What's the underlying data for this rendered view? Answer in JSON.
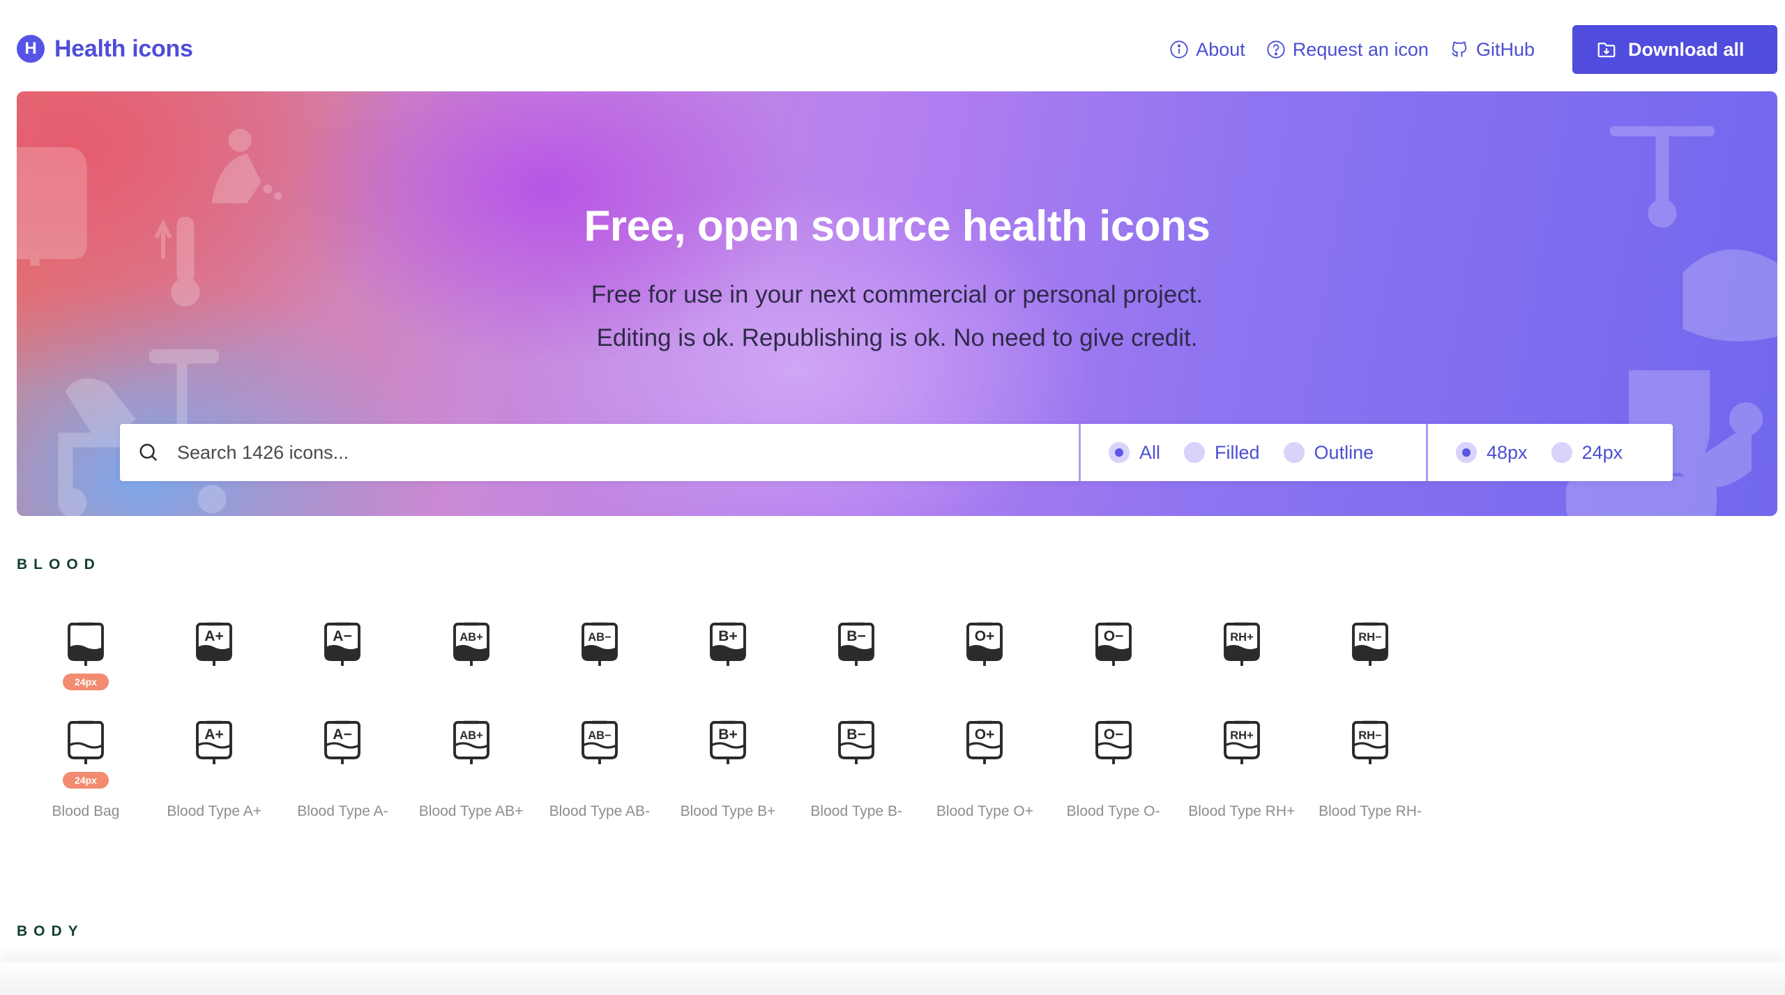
{
  "header": {
    "logo_letter": "H",
    "logo_text": "Health icons",
    "nav": {
      "about": "About",
      "request": "Request an icon",
      "github": "GitHub"
    },
    "download_label": "Download all"
  },
  "hero": {
    "title": "Free, open source health icons",
    "subtitle_line1": "Free for use in your next commercial or personal project.",
    "subtitle_line2": "Editing is ok. Republishing is ok. No need to give credit."
  },
  "search": {
    "placeholder": "Search 1426 icons...",
    "style_options": [
      "All",
      "Filled",
      "Outline"
    ],
    "style_selected": "All",
    "size_options": [
      "48px",
      "24px"
    ],
    "size_selected": "48px"
  },
  "sections": [
    {
      "title": "BLOOD",
      "badge": "24px",
      "icons": [
        {
          "label": "Blood Bag",
          "glyph": ""
        },
        {
          "label": "Blood Type A+",
          "glyph": "A+"
        },
        {
          "label": "Blood Type A-",
          "glyph": "A−"
        },
        {
          "label": "Blood Type AB+",
          "glyph": "AB+"
        },
        {
          "label": "Blood Type AB-",
          "glyph": "AB−"
        },
        {
          "label": "Blood Type B+",
          "glyph": "B+"
        },
        {
          "label": "Blood Type B-",
          "glyph": "B−"
        },
        {
          "label": "Blood Type O+",
          "glyph": "O+"
        },
        {
          "label": "Blood Type O-",
          "glyph": "O−"
        },
        {
          "label": "Blood Type RH+",
          "glyph": "RH+"
        },
        {
          "label": "Blood Type RH-",
          "glyph": "RH−"
        }
      ]
    },
    {
      "title": "BODY"
    }
  ],
  "colors": {
    "brand": "#4f4cde",
    "badge": "#f28b70",
    "section_title": "#123d34",
    "icon": "#2b2b2b"
  }
}
